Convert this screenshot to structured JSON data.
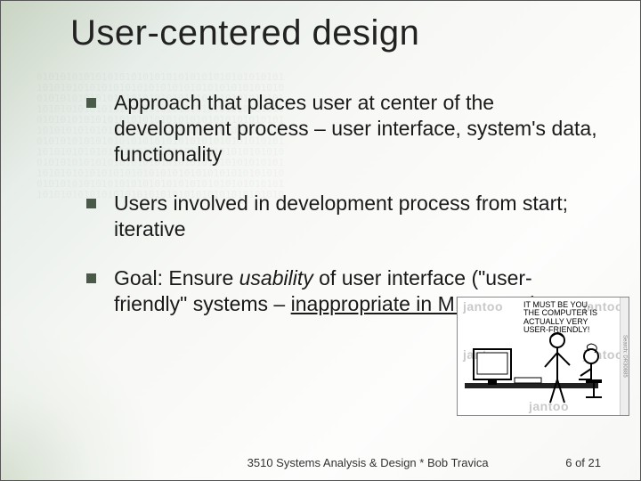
{
  "title": "User-centered design",
  "bullets": [
    {
      "html": "Approach that places user at center of the development process – user interface, system's data, functionality"
    },
    {
      "html": "Users involved in development process from start; iterative"
    },
    {
      "html": "Goal: Ensure <em>usability</em> of user interface (\"user-friendly\" systems – <u>inappropriate in MIS 3510!</u>)"
    }
  ],
  "cartoon": {
    "caption": "IT MUST BE YOU. THE COMPUTER IS ACTUALLY VERY USER-FRIENDLY!",
    "watermark": "jantoo",
    "sidebar": "Search: DR30885"
  },
  "footer": {
    "center": "3510 Systems Analysis & Design * Bob Travica",
    "page_current": 6,
    "page_total": 21,
    "page_label": "6 of 21"
  },
  "bg_noise": "010101010101010101010101010101010101010101\n101010101010101010101010101010101010101010\n010101010101010101010101010101010101010101\n101010101010101010101010101010101010101010\n010101010101010101010101010101010101010101\n101010101010101010101010101010101010101010\n010101010101010101010101010101010101010101\n101010101010101010101010101010101010101010\n010101010101010101010101010101010101010101\n101010101010101010101010101010101010101010\n010101010101010101010101010101010101010101\n101010101010101010101010101010101010101010"
}
